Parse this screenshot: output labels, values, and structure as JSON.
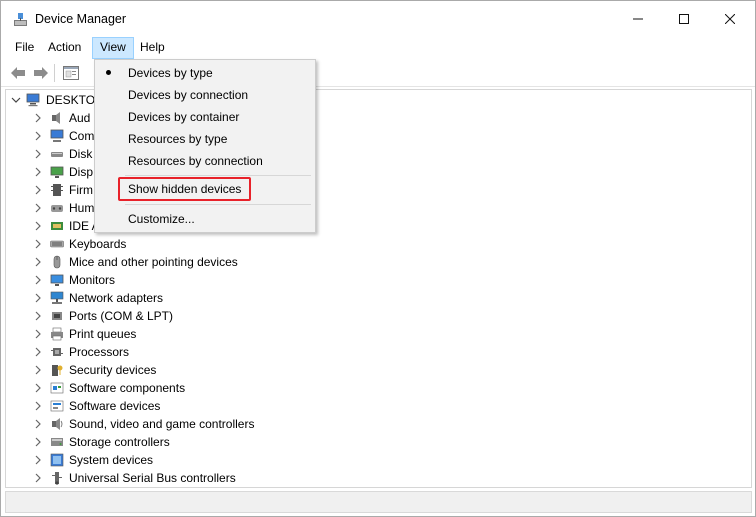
{
  "window": {
    "title": "Device Manager"
  },
  "menubar": {
    "file": "File",
    "action": "Action",
    "view": "View",
    "help": "Help"
  },
  "tree": {
    "root_label": "DESKTO",
    "categories": [
      {
        "label": "Aud",
        "icon": "audio-icon"
      },
      {
        "label": "Com",
        "icon": "computer-icon"
      },
      {
        "label": "Disk",
        "icon": "disk-icon"
      },
      {
        "label": "Disp",
        "icon": "display-icon"
      },
      {
        "label": "Firm",
        "icon": "firmware-icon"
      },
      {
        "label": "Hum",
        "icon": "hid-icon"
      },
      {
        "label": "IDE A",
        "icon": "ide-icon"
      },
      {
        "label": "Keyboards",
        "icon": "keyboard-icon"
      },
      {
        "label": "Mice and other pointing devices",
        "icon": "mouse-icon"
      },
      {
        "label": "Monitors",
        "icon": "monitor-icon"
      },
      {
        "label": "Network adapters",
        "icon": "network-icon"
      },
      {
        "label": "Ports (COM & LPT)",
        "icon": "port-icon"
      },
      {
        "label": "Print queues",
        "icon": "printer-icon"
      },
      {
        "label": "Processors",
        "icon": "processor-icon"
      },
      {
        "label": "Security devices",
        "icon": "security-icon"
      },
      {
        "label": "Software components",
        "icon": "software-component-icon"
      },
      {
        "label": "Software devices",
        "icon": "software-device-icon"
      },
      {
        "label": "Sound, video and game controllers",
        "icon": "sound-icon"
      },
      {
        "label": "Storage controllers",
        "icon": "storage-icon"
      },
      {
        "label": "System devices",
        "icon": "system-icon"
      },
      {
        "label": "Universal Serial Bus controllers",
        "icon": "usb-icon"
      }
    ]
  },
  "view_menu": {
    "items": [
      {
        "label": "Devices by type",
        "checked": true
      },
      {
        "label": "Devices by connection",
        "checked": false
      },
      {
        "label": "Devices by container",
        "checked": false
      },
      {
        "label": "Resources by type",
        "checked": false
      },
      {
        "label": "Resources by connection",
        "checked": false
      },
      {
        "label": "Show hidden devices",
        "checked": false,
        "highlighted": true
      },
      {
        "label": "Customize...",
        "checked": false
      }
    ]
  },
  "colors": {
    "menu_active_bg": "#cce8ff",
    "highlight_border": "#e8222a",
    "dropdown_bg": "#f2f2f2"
  }
}
